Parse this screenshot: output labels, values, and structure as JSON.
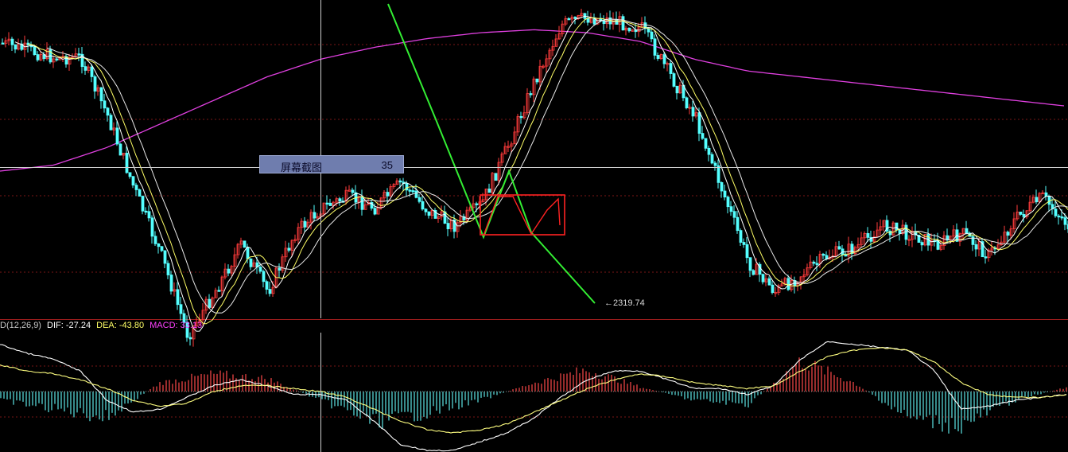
{
  "colors": {
    "background": "#000000",
    "grid": "#7a1616",
    "divider": "#9a1c1c",
    "up_candle": "#ff3b3b",
    "down_candle": "#54ffff",
    "ma_white": "#ffffff",
    "ma_yellow": "#ffff66",
    "ma_long": "#e040e0",
    "zigzag": "#33ee33",
    "box": "#ff2222",
    "crosshair": "#d0d0d0",
    "hist_pos": "#ff4a4a",
    "hist_neg": "#5ee7e7",
    "dif_line": "#ffffff",
    "dea_line": "#ffff80"
  },
  "tooltip": {
    "label": "屏幕截图",
    "value": "35"
  },
  "price_annotation": {
    "text": "←2319.74"
  },
  "macd_legend": {
    "name": "D(12,26,9)",
    "dif": "DIF: -27.24",
    "dea": "DEA: -43.80",
    "macd": "MACD: 33.13",
    "name_color": "#c8c8c8",
    "dif_color": "#ffffff",
    "dea_color": "#ffff66",
    "macd_color": "#ff40ff"
  },
  "chart_data": {
    "type": "candlestick+macd",
    "grid": true,
    "price_series": {
      "low": 2319.74,
      "trend_path": [
        [
          0,
          10
        ],
        [
          10,
          12
        ],
        [
          20,
          14
        ],
        [
          30,
          14
        ],
        [
          40,
          30
        ],
        [
          50,
          50
        ],
        [
          60,
          68
        ],
        [
          70,
          90
        ],
        [
          80,
          78
        ],
        [
          90,
          65
        ],
        [
          100,
          78
        ],
        [
          110,
          62
        ],
        [
          120,
          55
        ],
        [
          130,
          52
        ],
        [
          140,
          55
        ],
        [
          150,
          48
        ],
        [
          160,
          56
        ],
        [
          170,
          60
        ],
        [
          180,
          54
        ],
        [
          190,
          38
        ],
        [
          200,
          20
        ],
        [
          210,
          5
        ],
        [
          220,
          3
        ],
        [
          230,
          4
        ],
        [
          240,
          6
        ],
        [
          250,
          18
        ],
        [
          260,
          30
        ],
        [
          270,
          50
        ],
        [
          280,
          70
        ],
        [
          290,
          78
        ],
        [
          300,
          73
        ],
        [
          310,
          68
        ],
        [
          320,
          66
        ],
        [
          330,
          60
        ],
        [
          340,
          62
        ],
        [
          350,
          65
        ],
        [
          360,
          62
        ],
        [
          370,
          68
        ],
        [
          380,
          58
        ],
        [
          390,
          52
        ],
        [
          400,
          60
        ]
      ],
      "ma_long_path": [
        [
          0,
          50
        ],
        [
          20,
          48
        ],
        [
          40,
          42
        ],
        [
          60,
          34
        ],
        [
          80,
          26
        ],
        [
          100,
          18
        ],
        [
          120,
          12
        ],
        [
          140,
          8
        ],
        [
          160,
          5
        ],
        [
          180,
          3
        ],
        [
          200,
          2
        ],
        [
          220,
          3
        ],
        [
          240,
          6
        ],
        [
          260,
          12
        ],
        [
          280,
          16
        ],
        [
          300,
          18
        ],
        [
          320,
          20
        ],
        [
          340,
          22
        ],
        [
          360,
          24
        ],
        [
          380,
          26
        ],
        [
          400,
          28
        ]
      ]
    },
    "macd_series": {
      "dif": -27.24,
      "dea": -43.8,
      "macd": 33.13,
      "dif_path": [
        [
          0,
          32
        ],
        [
          10,
          26
        ],
        [
          20,
          22
        ],
        [
          30,
          14
        ],
        [
          40,
          -6
        ],
        [
          50,
          -14
        ],
        [
          60,
          -12
        ],
        [
          70,
          -4
        ],
        [
          80,
          4
        ],
        [
          90,
          8
        ],
        [
          100,
          4
        ],
        [
          110,
          -2
        ],
        [
          120,
          -2
        ],
        [
          130,
          -6
        ],
        [
          140,
          -20
        ],
        [
          150,
          -36
        ],
        [
          160,
          -40
        ],
        [
          170,
          -40
        ],
        [
          180,
          -34
        ],
        [
          190,
          -28
        ],
        [
          200,
          -18
        ],
        [
          210,
          -4
        ],
        [
          220,
          8
        ],
        [
          230,
          14
        ],
        [
          240,
          14
        ],
        [
          250,
          8
        ],
        [
          260,
          2
        ],
        [
          270,
          2
        ],
        [
          280,
          -2
        ],
        [
          290,
          4
        ],
        [
          300,
          22
        ],
        [
          310,
          34
        ],
        [
          320,
          32
        ],
        [
          330,
          30
        ],
        [
          340,
          28
        ],
        [
          350,
          14
        ],
        [
          360,
          -12
        ],
        [
          370,
          -10
        ],
        [
          380,
          -6
        ],
        [
          390,
          -4
        ],
        [
          400,
          -2
        ]
      ],
      "dea_path": [
        [
          0,
          18
        ],
        [
          10,
          14
        ],
        [
          20,
          12
        ],
        [
          30,
          8
        ],
        [
          40,
          2
        ],
        [
          50,
          -6
        ],
        [
          60,
          -10
        ],
        [
          70,
          -8
        ],
        [
          80,
          0
        ],
        [
          90,
          4
        ],
        [
          100,
          4
        ],
        [
          110,
          2
        ],
        [
          120,
          0
        ],
        [
          130,
          -4
        ],
        [
          140,
          -12
        ],
        [
          150,
          -20
        ],
        [
          160,
          -26
        ],
        [
          170,
          -28
        ],
        [
          180,
          -26
        ],
        [
          190,
          -22
        ],
        [
          200,
          -14
        ],
        [
          210,
          -6
        ],
        [
          220,
          2
        ],
        [
          230,
          8
        ],
        [
          240,
          12
        ],
        [
          250,
          10
        ],
        [
          260,
          6
        ],
        [
          270,
          4
        ],
        [
          280,
          2
        ],
        [
          290,
          4
        ],
        [
          300,
          14
        ],
        [
          310,
          24
        ],
        [
          320,
          28
        ],
        [
          330,
          30
        ],
        [
          340,
          28
        ],
        [
          350,
          20
        ],
        [
          360,
          6
        ],
        [
          370,
          -2
        ],
        [
          380,
          -4
        ],
        [
          390,
          -4
        ],
        [
          400,
          -2
        ]
      ],
      "histogram_profile": [
        [
          0,
          -4
        ],
        [
          20,
          -8
        ],
        [
          40,
          -12
        ],
        [
          60,
          4
        ],
        [
          80,
          8
        ],
        [
          100,
          6
        ],
        [
          120,
          -4
        ],
        [
          140,
          -14
        ],
        [
          160,
          -10
        ],
        [
          180,
          -4
        ],
        [
          200,
          4
        ],
        [
          220,
          10
        ],
        [
          240,
          2
        ],
        [
          260,
          -4
        ],
        [
          280,
          -6
        ],
        [
          300,
          14
        ],
        [
          320,
          4
        ],
        [
          340,
          -12
        ],
        [
          360,
          -16
        ],
        [
          380,
          -4
        ],
        [
          400,
          2
        ]
      ]
    }
  }
}
